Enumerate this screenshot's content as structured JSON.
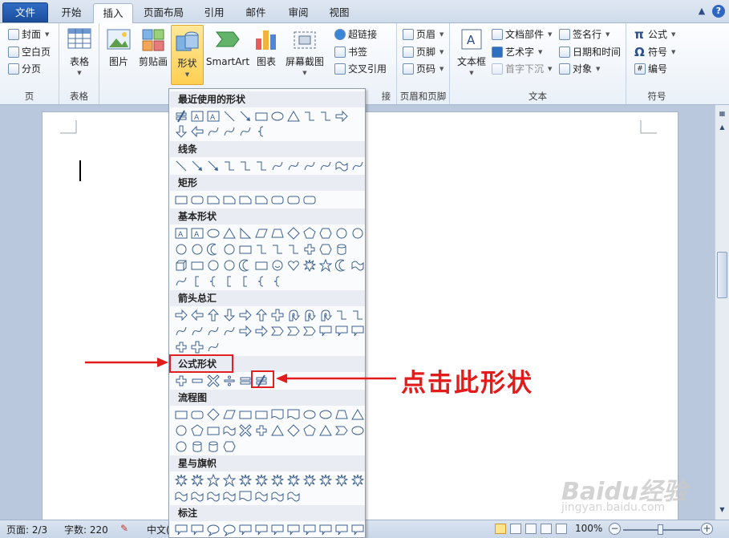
{
  "tabs": [
    {
      "label": "文件"
    },
    {
      "label": "开始"
    },
    {
      "label": "插入"
    },
    {
      "label": "页面布局"
    },
    {
      "label": "引用"
    },
    {
      "label": "邮件"
    },
    {
      "label": "审阅"
    },
    {
      "label": "视图"
    }
  ],
  "ribbon": {
    "pages_group": {
      "label": "页",
      "cover": "封面",
      "blank": "空白页",
      "break": "分页"
    },
    "table_group": {
      "label": "表格",
      "table": "表格"
    },
    "illustrations": {
      "picture": "图片",
      "clipart": "剪贴画",
      "shapes": "形状",
      "smartart": "SmartArt",
      "chart": "图表",
      "screenshot": "屏幕截图"
    },
    "links": {
      "hyperlink": "超链接",
      "bookmark": "书签",
      "crossref": "交叉引用",
      "label_tail": "接"
    },
    "header_footer": {
      "label": "页眉和页脚",
      "header": "页眉",
      "footer": "页脚",
      "pagenum": "页码"
    },
    "text_group": {
      "label": "文本",
      "textbox": "文本框",
      "quickparts": "文档部件",
      "wordart": "艺术字",
      "dropcap": "首字下沉",
      "signature": "签名行",
      "datetime": "日期和时间",
      "object": "对象"
    },
    "symbols": {
      "label": "符号",
      "equation": "公式",
      "symbol": "符号",
      "number": "编号"
    }
  },
  "shapes_menu": {
    "sections": {
      "recent": "最近使用的形状",
      "lines": "线条",
      "rectangles": "矩形",
      "basic": "基本形状",
      "arrows": "箭头总汇",
      "equation": "公式形状",
      "flowchart": "流程图",
      "stars": "星与旗帜",
      "callouts": "标注"
    }
  },
  "annotation": "点击此形状",
  "status": {
    "page": "页面: 2/3",
    "words": "字数: 220",
    "lang": "中文(",
    "zoom": "100%"
  },
  "watermark": {
    "logo": "Baidu经验",
    "url": "jingyan.baidu.com"
  }
}
